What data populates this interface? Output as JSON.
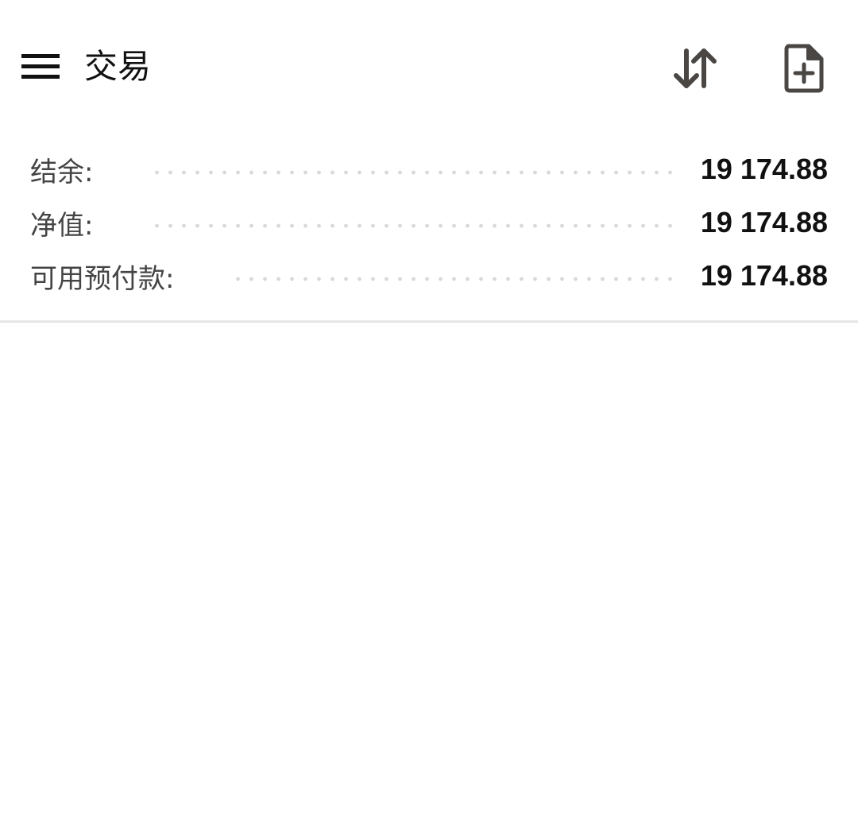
{
  "header": {
    "title": "交易",
    "icons": {
      "menu": "hamburger-menu-icon",
      "sort": "sort-arrows-icon",
      "new_order": "document-plus-icon"
    },
    "icon_color": "#4a4644"
  },
  "summary": {
    "rows": [
      {
        "label": "结余:",
        "value": "19 174.88"
      },
      {
        "label": "净值:",
        "value": "19 174.88"
      },
      {
        "label": "可用预付款:",
        "value": "19 174.88"
      }
    ]
  }
}
